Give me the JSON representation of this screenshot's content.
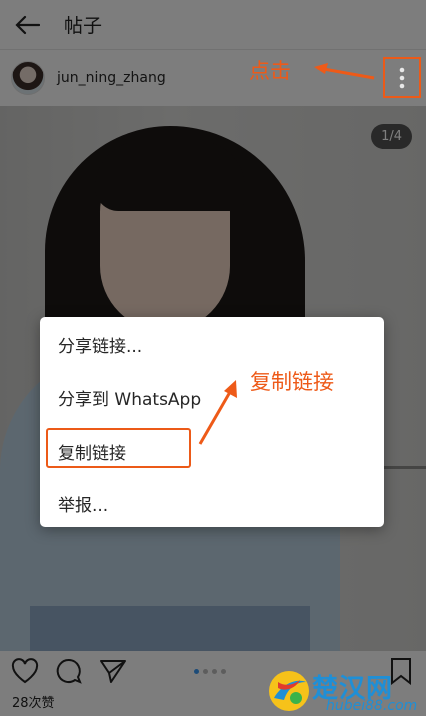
{
  "topbar": {
    "title": "帖子"
  },
  "post": {
    "username": "jun_ning_zhang",
    "image_counter": "1/4",
    "likes": "28次赞",
    "carousel": {
      "dots": 4,
      "active": 0
    }
  },
  "menu": {
    "items": [
      {
        "label": "分享链接..."
      },
      {
        "label": "分享到 WhatsApp"
      },
      {
        "label": "复制链接"
      },
      {
        "label": "举报..."
      }
    ]
  },
  "annotations": {
    "click_label": "点击",
    "copy_label": "复制链接",
    "color": "#ee5a18"
  },
  "watermark": {
    "text": "楚汉网",
    "url": "hubei88.com"
  },
  "icons": {
    "back": "back-arrow-icon",
    "more": "more-vertical-icon",
    "like": "heart-icon",
    "comment": "comment-icon",
    "share": "send-icon",
    "save": "bookmark-icon"
  },
  "colors": {
    "accent": "#3897f0",
    "highlight": "#ec5a18"
  }
}
